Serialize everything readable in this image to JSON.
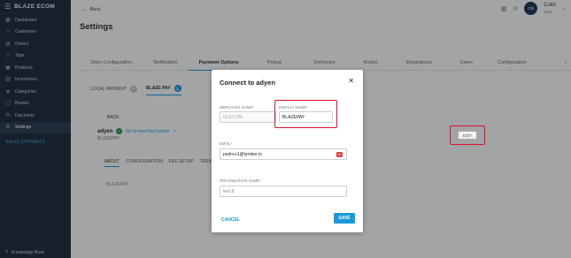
{
  "app": {
    "brand": "BLAZE ECOM"
  },
  "sidebar": {
    "items": [
      {
        "label": "Dashboard",
        "icon": "dashboard-icon"
      },
      {
        "label": "Customers",
        "icon": "customers-icon"
      },
      {
        "label": "Orders",
        "icon": "orders-icon"
      },
      {
        "label": "Tags",
        "icon": "tag-icon"
      },
      {
        "label": "Products",
        "icon": "products-icon"
      },
      {
        "label": "Inventories",
        "icon": "inventories-icon"
      },
      {
        "label": "Categories",
        "icon": "categories-icon"
      },
      {
        "label": "Brands",
        "icon": "brands-icon"
      },
      {
        "label": "Discounts",
        "icon": "discounts-icon"
      },
      {
        "label": "Settings",
        "icon": "settings-icon"
      }
    ],
    "active": "Settings",
    "section": "SALES CHANNELS",
    "knowledge_base": "Knowledge Base"
  },
  "header": {
    "back_label": "Back",
    "user_name": "Colin",
    "user_role": "Staff",
    "user_initials": "CB"
  },
  "page": {
    "title": "Settings",
    "tabs": [
      "Store Configuration",
      "Notification",
      "Payment Options",
      "Pickup",
      "Deliveries",
      "Kiosks",
      "Integrations",
      "Users",
      "Configuration"
    ],
    "active_tab": "Payment Options",
    "subtabs": [
      {
        "label": "LOCAL PAYMENT",
        "count": "0"
      },
      {
        "label": "BLAZE PAY",
        "count": "1"
      }
    ],
    "back2_label": "BACK",
    "provider": "adyen",
    "merchant_link": "Go to merchant portal",
    "provider_sub": "BLAZEPAY",
    "provider_tabs": [
      "ABOUT",
      "CONFIGURATION",
      "FEE SETUP",
      "TERM"
    ],
    "provider_value": "BLAZEPAY",
    "edit_label": "EDIT"
  },
  "modal": {
    "title": "Connect to adyen",
    "merchant_label": "MERCHANT NAME*",
    "merchant_value": "GLECOM",
    "display_label": "DISPLAY NAME*",
    "display_value": "BLAZEPAY",
    "email_label": "EMAIL*",
    "email_value": "pedro+1@tymber.io",
    "org_label": "ORGANIZATION NAME*",
    "org_value": "test 8",
    "cancel_label": "CANCEL",
    "save_label": "SAVE"
  },
  "colors": {
    "accent": "#1a9ad6",
    "sidebar": "#223040",
    "highlight": "#e0102b"
  }
}
